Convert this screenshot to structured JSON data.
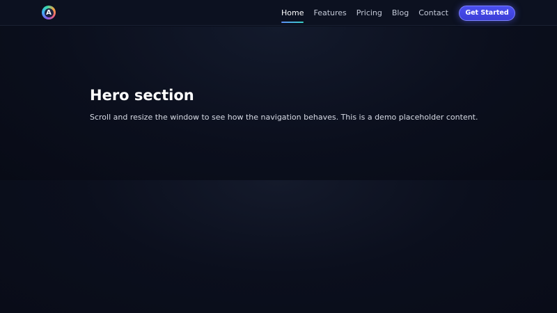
{
  "brand": {
    "logo_letter": "A"
  },
  "nav": {
    "items": [
      {
        "label": "Home",
        "active": true
      },
      {
        "label": "Features",
        "active": false
      },
      {
        "label": "Pricing",
        "active": false
      },
      {
        "label": "Blog",
        "active": false
      },
      {
        "label": "Contact",
        "active": false
      }
    ],
    "cta_label": "Get Started"
  },
  "hero": {
    "title": "Hero section",
    "text": "Scroll and resize the window to see how the navigation behaves. This is a demo placeholder content."
  },
  "colors": {
    "background": "#090d1a",
    "accent": "#4b4ff0",
    "underline_start": "#5f8df7",
    "underline_end": "#36d1c6"
  }
}
